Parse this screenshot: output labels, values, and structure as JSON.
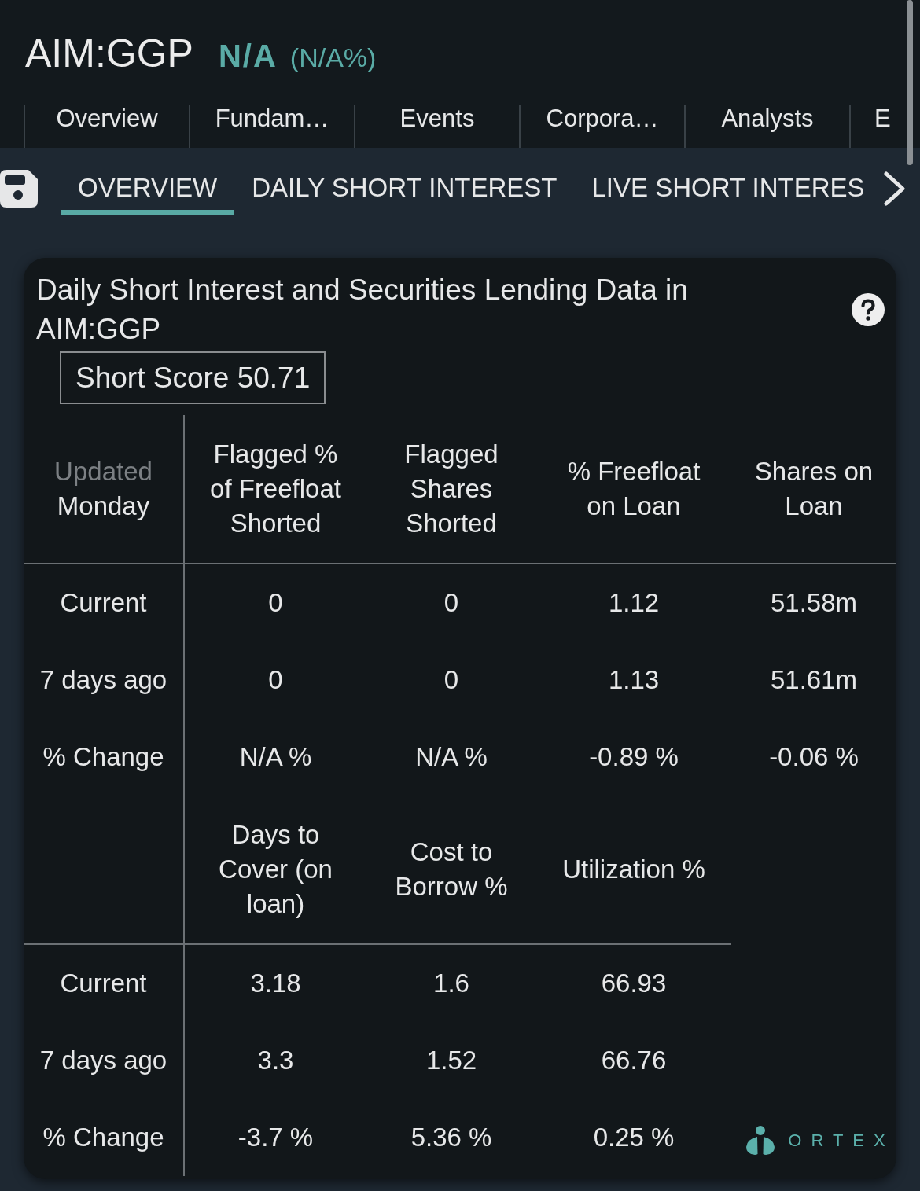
{
  "header": {
    "symbol": "AIM:GGP",
    "price": "N/A",
    "change": "(N/A%)"
  },
  "nav_tabs": [
    {
      "label": "Overview"
    },
    {
      "label": "Fundam…"
    },
    {
      "label": "Events"
    },
    {
      "label": "Corpora…"
    },
    {
      "label": "Analysts"
    },
    {
      "label": "E"
    }
  ],
  "sub_tabs": [
    {
      "label": "OVERVIEW",
      "selected": true
    },
    {
      "label": "DAILY SHORT INTEREST",
      "selected": false
    },
    {
      "label": "LIVE SHORT INTERES",
      "selected": false
    }
  ],
  "card": {
    "title": "Daily Short Interest and Securities Lending Data in AIM:GGP",
    "short_score": "Short Score 50.71",
    "sections": [
      {
        "corner": {
          "label": "Updated",
          "day": "Monday"
        },
        "columns": [
          "Flagged % of Freefloat Shorted",
          "Flagged Shares Shorted",
          "% Freefloat on Loan",
          "Shares on Loan"
        ],
        "rows": [
          {
            "label": "Current",
            "cells": [
              "0",
              "0",
              "1.12",
              "51.58m"
            ]
          },
          {
            "label": "7 days ago",
            "cells": [
              "0",
              "0",
              "1.13",
              "51.61m"
            ]
          },
          {
            "label": "% Change",
            "cells": [
              "N/A %",
              "N/A %",
              "-0.89 %",
              "-0.06 %"
            ]
          }
        ]
      },
      {
        "columns": [
          "Days to Cover (on loan)",
          "Cost to Borrow %",
          "Utilization %"
        ],
        "rows": [
          {
            "label": "Current",
            "cells": [
              "3.18",
              "1.6",
              "66.93"
            ]
          },
          {
            "label": "7 days ago",
            "cells": [
              "3.3",
              "1.52",
              "66.76"
            ]
          },
          {
            "label": "% Change",
            "cells": [
              "-3.7 %",
              "5.36 %",
              "0.25 %"
            ]
          }
        ]
      }
    ],
    "logo": "ORTEX"
  }
}
